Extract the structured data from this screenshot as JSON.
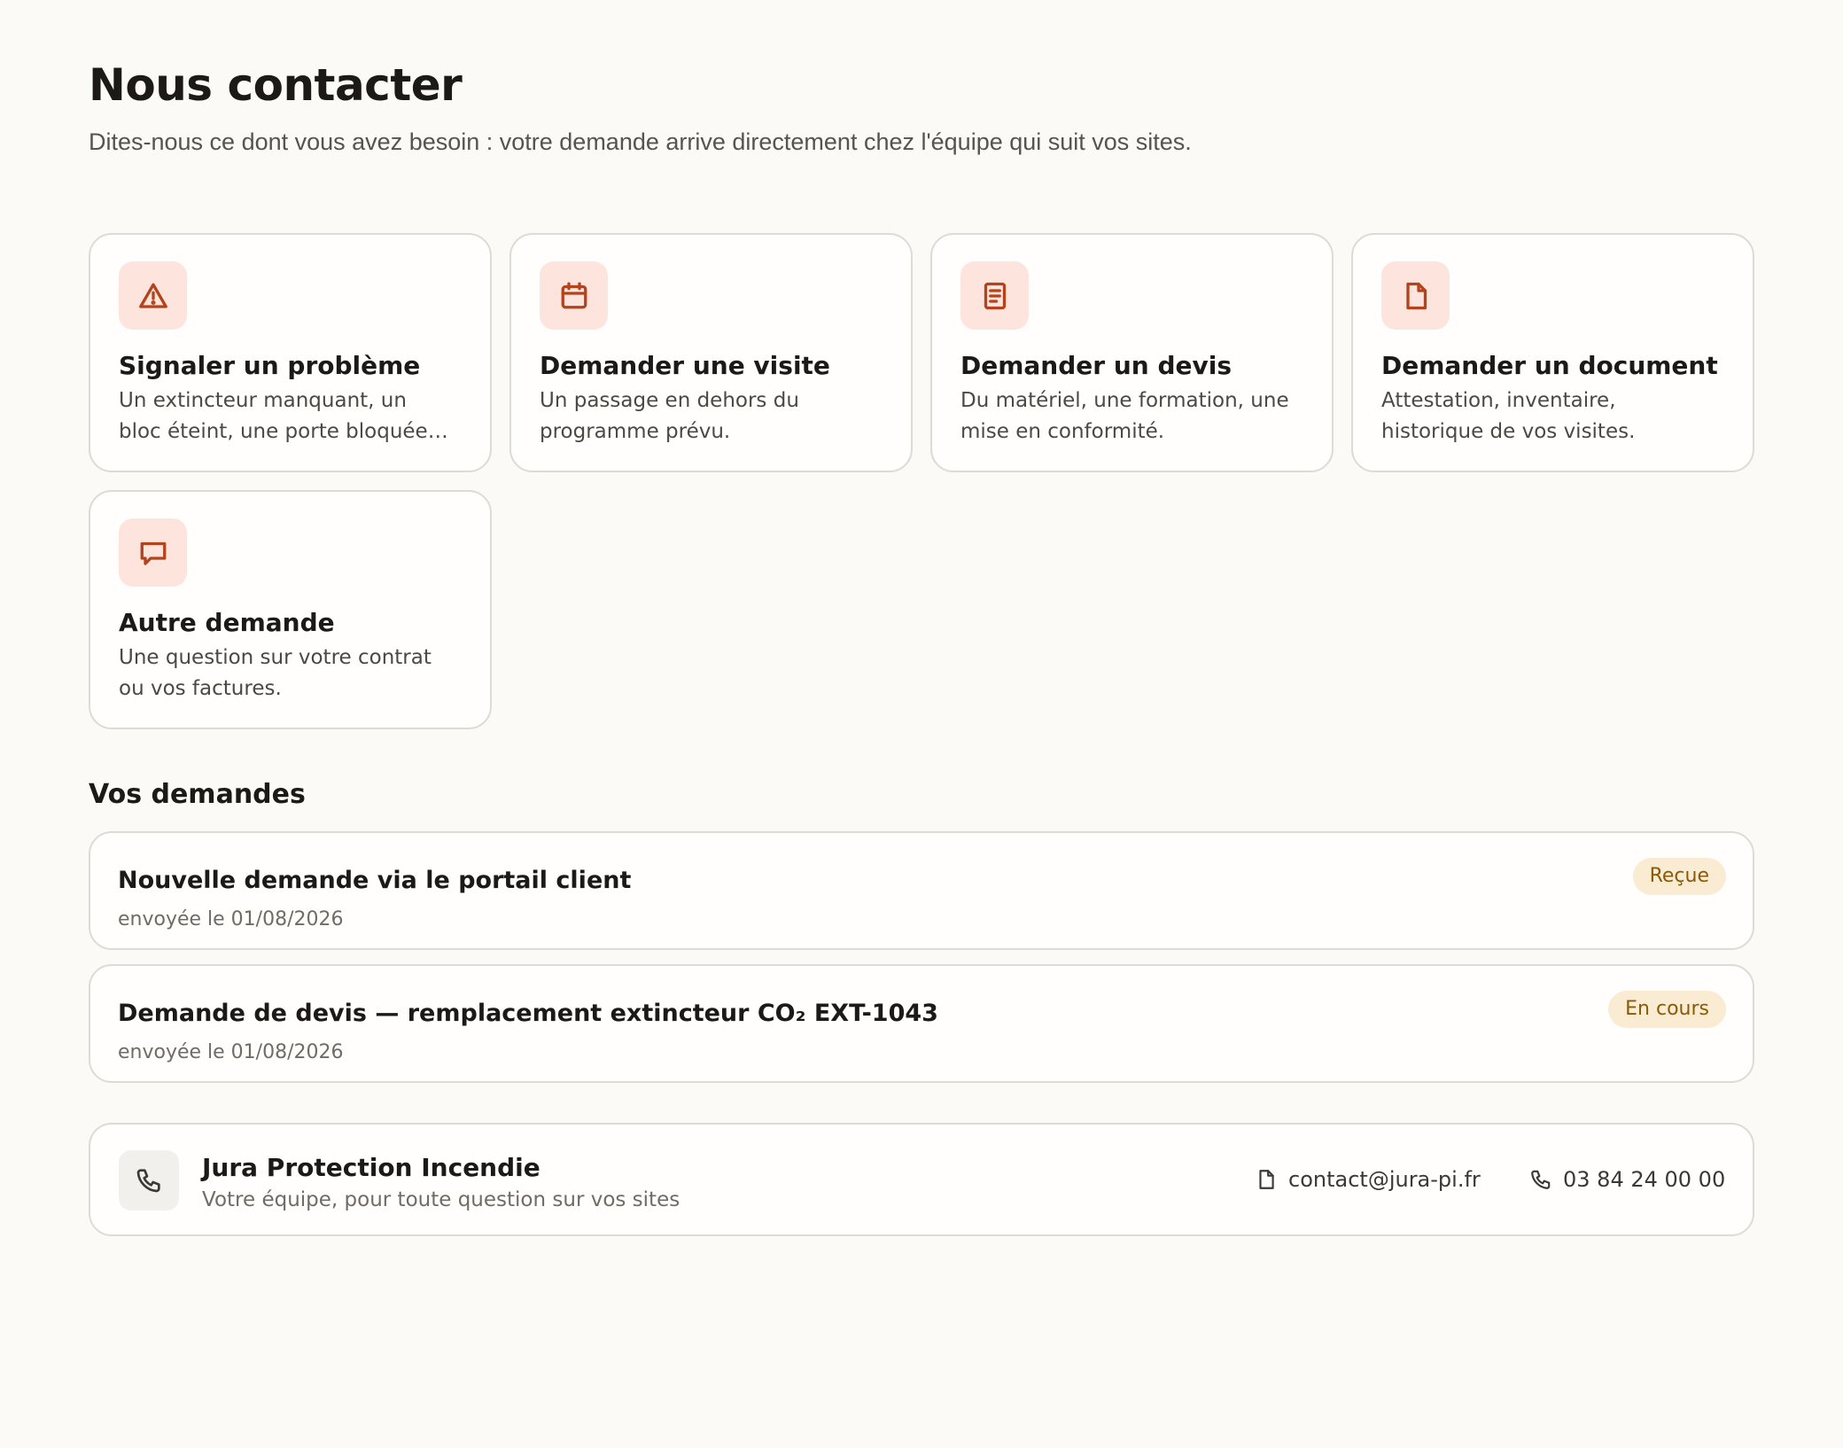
{
  "page": {
    "title": "Nous contacter",
    "subtitle": "Dites-nous ce dont vous avez besoin : votre demande arrive directement chez l'équipe qui suit vos sites."
  },
  "colors": {
    "background": "#fbfaf7",
    "accent": "#b3431d",
    "icon_tile": "#fde4dc",
    "badge_bg": "#f9ecd3",
    "badge_text": "#8a5a08"
  },
  "request_types": [
    {
      "icon": "warning-icon",
      "title": "Signaler un problème",
      "description": "Un extincteur manquant, un bloc éteint, une porte bloquée…"
    },
    {
      "icon": "calendar-icon",
      "title": "Demander une visite",
      "description": "Un passage en dehors du programme prévu."
    },
    {
      "icon": "quote-icon",
      "title": "Demander un devis",
      "description": "Du matériel, une formation, une mise en conformité."
    },
    {
      "icon": "document-icon",
      "title": "Demander un document",
      "description": "Attestation, inventaire, historique de vos visites."
    },
    {
      "icon": "chat-icon",
      "title": "Autre demande",
      "description": "Une question sur votre contrat ou vos factures."
    }
  ],
  "requests": {
    "heading": "Vos demandes",
    "items": [
      {
        "title": "Nouvelle demande via le portail client",
        "date": "envoyée le 01/08/2026",
        "status": "Reçue"
      },
      {
        "title": "Demande de devis — remplacement extincteur CO₂ EXT-1043",
        "date": "envoyée le 01/08/2026",
        "status": "En cours"
      }
    ]
  },
  "contact": {
    "icon": "phone-icon",
    "name": "Jura Protection Incendie",
    "tagline": "Votre équipe, pour toute question sur vos sites",
    "email": "contact@jura-pi.fr",
    "phone": "03 84 24 00 00"
  }
}
